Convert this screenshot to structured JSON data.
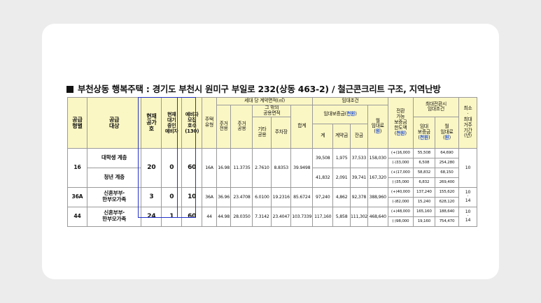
{
  "title": "부천상동 행복주택 : 경기도 부천시 원미구 부일로 232(상동 463-2) / 철근콘크리트 구조, 지역난방",
  "headers": {
    "supply_type": "공급\n형별",
    "supply_target": "공급\n대상",
    "current_vacancy": "현재\n공가\n호",
    "current_waiting": "현재\n대기\n중인\n예비자",
    "reserve_recruit": "예비자\n모집\n호수\n(130)",
    "house_type": "주택\n유형",
    "area_group": "세대 당 계약면적(㎡)",
    "resident_private": "주거\n전용",
    "resident_common": "주거\n공용",
    "other_common_group": "그 밖의\n공용면적",
    "other_common": "기타\n공용",
    "parking": "주차장",
    "area_total": "합계",
    "rent_group": "임대조건",
    "deposit_group_text": "임대보증금(",
    "unit_thousand": "천원",
    "deposit_group_close": ")",
    "total": "계",
    "contract_fee": "계약금",
    "balance": "잔금",
    "monthly_rent_text": "월\n임대료\n(",
    "unit_won": "원",
    "monthly_rent_close": ")",
    "convertible_text": "전환\n가능\n보증금\n한도액\n(",
    "convertible_close": ")",
    "max_conv_group": "최대전환시\n임대조건",
    "conv_deposit_text": "임대\n보증금\n(",
    "conv_monthly_text": "월\n임대료\n(",
    "min_residence": "최소\n·\n최대\n거주\n기간\n(년)"
  },
  "rows": [
    {
      "type": "16",
      "targets": [
        "대학생 계층",
        "청년 계층"
      ],
      "vacancy": "20",
      "waiting": "0",
      "recruit": "60",
      "house_type": "16A",
      "private": "16.98",
      "common": "11.3735",
      "other": "2.7610",
      "parking": "8.8353",
      "area_total": "39.9498",
      "sub": [
        {
          "total": "39,508",
          "contract": "1,975",
          "balance": "37,533",
          "monthly": "158,030",
          "conv": [
            "(+)16,000",
            "(-)33,000"
          ],
          "conv_dep": [
            "55,508",
            "6,508"
          ],
          "conv_mon": [
            "64,690",
            "254,280"
          ]
        },
        {
          "total": "41,832",
          "contract": "2,091",
          "balance": "39,741",
          "monthly": "167,320",
          "conv": [
            "(+)17,000",
            "(-)35,000"
          ],
          "conv_dep": [
            "58,832",
            "6,832"
          ],
          "conv_mon": [
            "68,150",
            "269,400"
          ]
        }
      ],
      "period": "10"
    },
    {
      "type": "36A",
      "targets": [
        "신혼부부·\n한부모가족"
      ],
      "vacancy": "3",
      "waiting": "0",
      "recruit": "10",
      "house_type": "36A",
      "private": "36.96",
      "common": "23.4708",
      "other": "6.0100",
      "parking": "19.2316",
      "area_total": "85.6724",
      "sub": [
        {
          "total": "97,240",
          "contract": "4,862",
          "balance": "92,378",
          "monthly": "388,960",
          "conv": [
            "(+)40,000",
            "(-)82,000"
          ],
          "conv_dep": [
            "137,240",
            "15,240"
          ],
          "conv_mon": [
            "155,620",
            "628,120"
          ]
        }
      ],
      "period": "10\n·\n14"
    },
    {
      "type": "44",
      "targets": [
        "신혼부부·\n한부모가족"
      ],
      "vacancy": "24",
      "waiting": "1",
      "recruit": "60",
      "house_type": "44",
      "private": "44.98",
      "common": "28.0350",
      "other": "7.3142",
      "parking": "23.4047",
      "area_total": "103.7339",
      "sub": [
        {
          "total": "117,160",
          "contract": "5,858",
          "balance": "111,302",
          "monthly": "468,640",
          "conv": [
            "(+)48,000",
            "(-)98,000"
          ],
          "conv_dep": [
            "165,160",
            "19,160"
          ],
          "conv_mon": [
            "188,640",
            "754,470"
          ]
        }
      ],
      "period": "10\n·\n14"
    }
  ]
}
